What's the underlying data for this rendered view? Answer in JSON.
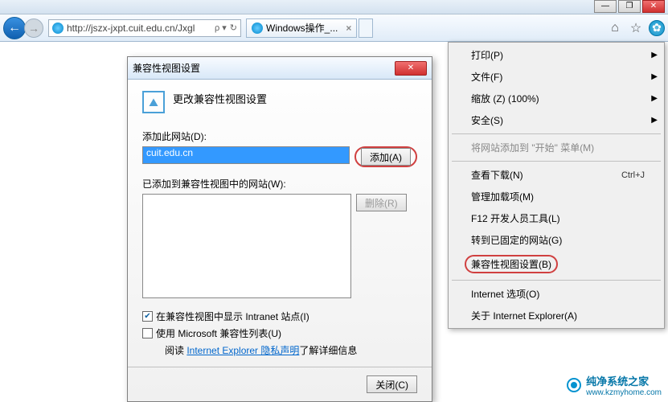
{
  "window_controls": {
    "min": "—",
    "max": "❐",
    "close": "✕"
  },
  "navbar": {
    "back_glyph": "←",
    "fwd_glyph": "→",
    "url": "http://jszx-jxpt.cuit.edu.cn/Jxgl",
    "url_tail": "ρ ▾",
    "refresh_glyph": "↻",
    "tab_title": "Windows操作_...",
    "tab_close": "×",
    "home_glyph": "⌂",
    "star_glyph": "☆",
    "gear_glyph": "✿"
  },
  "tools_menu": {
    "items": [
      {
        "label": "打印(P)",
        "submenu": true
      },
      {
        "label": "文件(F)",
        "submenu": true
      },
      {
        "label": "缩放 (Z) (100%)",
        "submenu": true
      },
      {
        "label": "安全(S)",
        "submenu": true
      }
    ],
    "add_start": "将网站添加到 \"开始\" 菜单(M)",
    "items2": [
      {
        "label": "查看下载(N)",
        "shortcut": "Ctrl+J"
      },
      {
        "label": "管理加载项(M)"
      },
      {
        "label": "F12 开发人员工具(L)"
      },
      {
        "label": "转到已固定的网站(G)"
      }
    ],
    "compat": "兼容性视图设置(B)",
    "items3": [
      {
        "label": "Internet 选项(O)"
      },
      {
        "label": "关于 Internet Explorer(A)"
      }
    ]
  },
  "dialog": {
    "title": "兼容性视图设置",
    "heading": "更改兼容性视图设置",
    "add_site_label": "添加此网站(D):",
    "add_site_value": "cuit.edu.cn",
    "add_btn": "添加(A)",
    "added_label": "已添加到兼容性视图中的网站(W):",
    "remove_btn": "删除(R)",
    "cb1_label": "在兼容性视图中显示 Intranet 站点(I)",
    "cb2_label": "使用 Microsoft 兼容性列表(U)",
    "read_prefix": "阅读 ",
    "privacy_link": "Internet Explorer 隐私声明",
    "read_suffix": "了解详细信息",
    "close_btn": "关闭(C)",
    "icon_glyph": "⛰"
  },
  "watermark": {
    "name": "纯净系统之家",
    "url": "www.kzmyhome.com"
  }
}
